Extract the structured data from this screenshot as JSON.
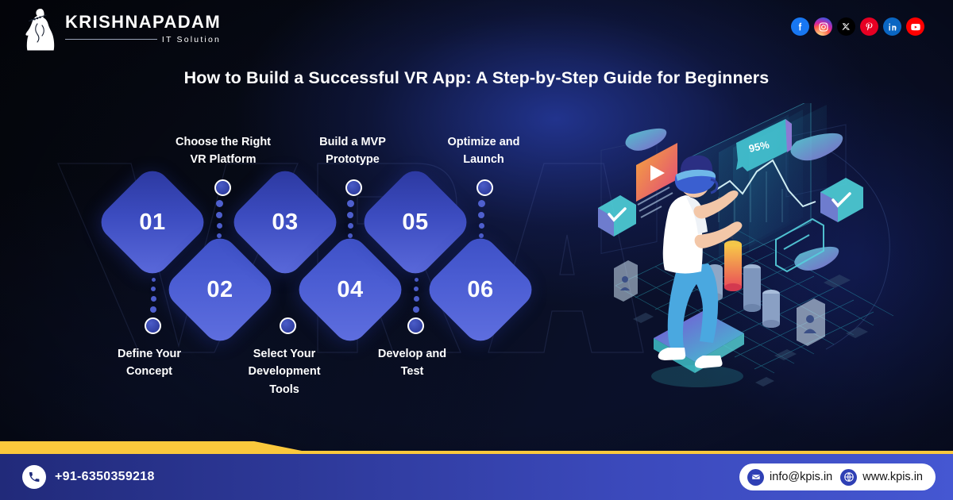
{
  "brand": {
    "logo_icon": "krishna-flute-icon",
    "name": "KRISHNAPADAM",
    "tagline": "IT Solution"
  },
  "header": {
    "socials": [
      {
        "name": "facebook-icon",
        "label": "Facebook",
        "color": "#1877F2"
      },
      {
        "name": "instagram-icon",
        "label": "Instagram",
        "color": "#E1306C"
      },
      {
        "name": "x-twitter-icon",
        "label": "X",
        "color": "#000000"
      },
      {
        "name": "pinterest-icon",
        "label": "Pinterest",
        "color": "#E60023"
      },
      {
        "name": "linkedin-icon",
        "label": "LinkedIn",
        "color": "#0A66C2"
      },
      {
        "name": "youtube-icon",
        "label": "YouTube",
        "color": "#FF0000"
      }
    ]
  },
  "title": "How to Build a Successful VR App: A Step-by-Step Guide for Beginners",
  "watermark_text": "VR APP",
  "steps": [
    {
      "number": "01",
      "label": "Define Your\nConcept",
      "position": "bottom"
    },
    {
      "number": "02",
      "label": "Choose the Right\nVR Platform",
      "position": "top"
    },
    {
      "number": "03",
      "label": "Select Your\nDevelopment\nTools",
      "position": "bottom"
    },
    {
      "number": "04",
      "label": "Build a MVP\nPrototype",
      "position": "top"
    },
    {
      "number": "05",
      "label": "Develop and\nTest",
      "position": "bottom"
    },
    {
      "number": "06",
      "label": "Optimize and\nLaunch",
      "position": "top"
    }
  ],
  "step_labels": {
    "top": [
      {
        "line1": "Choose the Right",
        "line2": "VR Platform",
        "line3": ""
      },
      {
        "line1": "Build a MVP",
        "line2": "Prototype",
        "line3": ""
      },
      {
        "line1": "Optimize and",
        "line2": "Launch",
        "line3": ""
      }
    ],
    "bottom": [
      {
        "line1": "Define Your",
        "line2": "Concept",
        "line3": ""
      },
      {
        "line1": "Select Your",
        "line2": "Development",
        "line3": "Tools"
      },
      {
        "line1": "Develop and",
        "line2": "Test",
        "line3": ""
      }
    ]
  },
  "illustration": {
    "name": "vr-user-isometric-illustration",
    "badge_value": "95%",
    "elements": [
      "vr-headset-person",
      "holographic-screens",
      "line-chart",
      "bar-chart-cylinders",
      "checkmark-cards",
      "video-play-card",
      "clouds",
      "user-avatar-cards",
      "grid-floor",
      "standing-platform"
    ]
  },
  "footer": {
    "phone_icon": "phone-icon",
    "phone": "+91-6350359218",
    "email_icon": "envelope-icon",
    "email": "info@kpis.in",
    "web_icon": "globe-icon",
    "website": "www.kpis.in"
  },
  "colors": {
    "accent_yellow": "#FBC83C",
    "footer_blue_start": "#212a7a",
    "footer_blue_end": "#4557d2",
    "diamond_start": "#2a369c",
    "diamond_end": "#6070e0",
    "background_dark": "#05070f"
  }
}
